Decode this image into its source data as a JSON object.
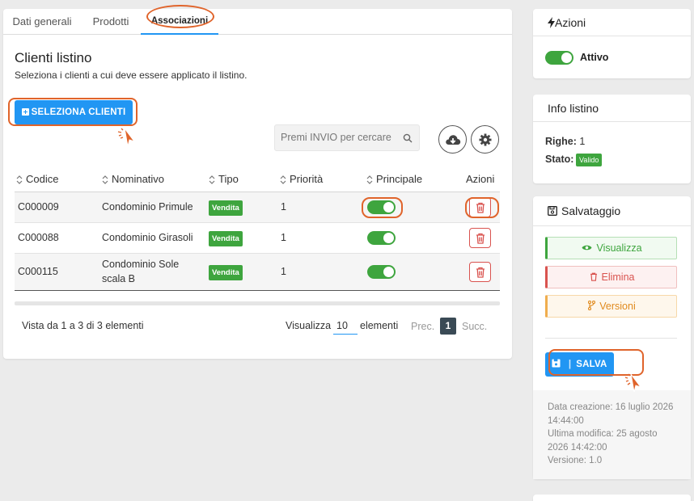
{
  "tabs": [
    "Dati generali",
    "Prodotti",
    "Associazioni"
  ],
  "main": {
    "title": "Clienti listino",
    "subtitle": "Seleziona i clienti a cui deve essere applicato il listino.",
    "select_button": "SELEZIONA CLIENTI",
    "search_placeholder": "Premi INVIO per cercare"
  },
  "table": {
    "headers": [
      "Codice",
      "Nominativo",
      "Tipo",
      "Priorità",
      "Principale",
      "Azioni"
    ],
    "rows": [
      {
        "code": "C000009",
        "name": "Condominio Primule",
        "type": "Vendita",
        "priority": "1",
        "principal": true
      },
      {
        "code": "C000088",
        "name": "Condominio Girasoli",
        "type": "Vendita",
        "priority": "1",
        "principal": true
      },
      {
        "code": "C000115",
        "name_line1": "Condominio Sole",
        "name_line2": "scala B",
        "type": "Vendita",
        "priority": "1",
        "principal": true
      }
    ]
  },
  "footer": {
    "info": "Vista da 1 a 3 di 3 elementi",
    "show_label": "Visualizza",
    "page_size": "10",
    "elements_label": "elementi",
    "prev": "Prec.",
    "current_page": "1",
    "next": "Succ."
  },
  "sidebar": {
    "actions": {
      "title": "Azioni",
      "toggle_label": "Attivo"
    },
    "info": {
      "title": "Info listino",
      "rows_label": "Righe:",
      "rows_value": "1",
      "status_label": "Stato:",
      "status_value": "Valido"
    },
    "save": {
      "title": "Salvataggio",
      "view": "Visualizza",
      "delete": "Elimina",
      "versions": "Versioni",
      "save_button": "SALVA",
      "meta_line1": "Data creazione: 16 luglio 2026",
      "meta_line2": "14:44:00",
      "meta_line3": "Ultima modifica: 25 agosto",
      "meta_line4": "2026 14:42:00",
      "meta_line5": "Versione: 1.0"
    }
  },
  "colors": {
    "primary": "#2196f3",
    "success": "#3ea53e",
    "danger": "#d9534f",
    "warning": "#f0ad4e",
    "annotation": "#e0642b"
  }
}
